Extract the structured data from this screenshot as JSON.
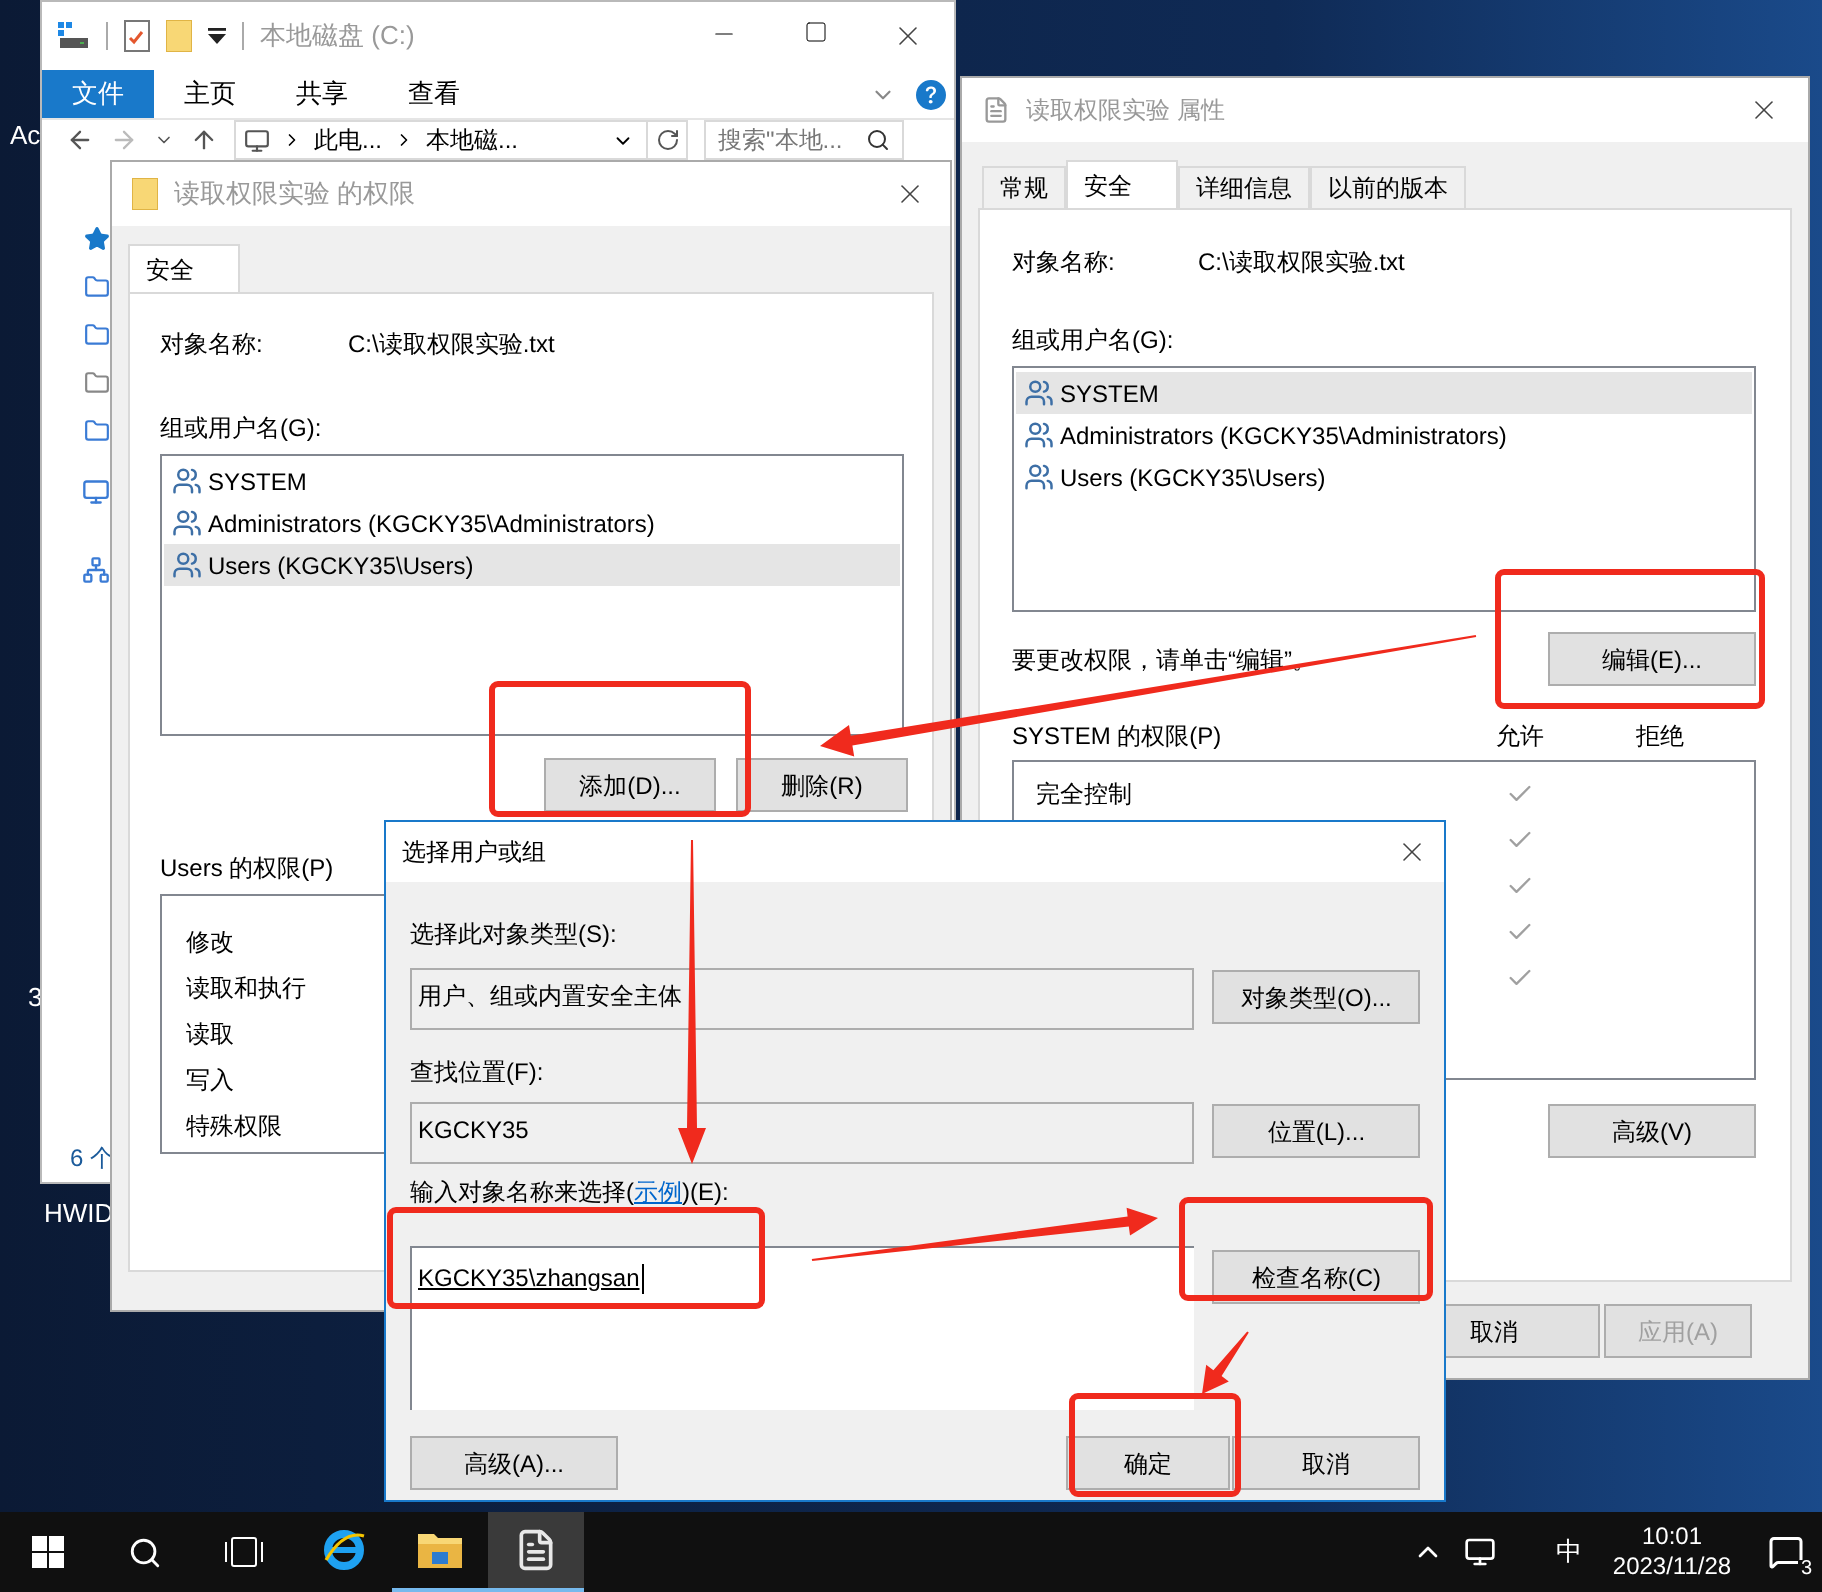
{
  "desktop": {
    "icons": [
      {
        "label": "Ac"
      },
      {
        "label": "3"
      },
      {
        "label": "HWID"
      }
    ]
  },
  "explorer": {
    "title": "本地磁盘 (C:)",
    "ribbon_tabs": [
      {
        "label": "文件",
        "selected": true
      },
      {
        "label": "主页",
        "selected": false
      },
      {
        "label": "共享",
        "selected": false
      },
      {
        "label": "查看",
        "selected": false
      }
    ],
    "breadcrumb": [
      "此电...",
      "本地磁..."
    ],
    "search": {
      "placeholder": "搜索\"本地..."
    },
    "status_bar": "6 个"
  },
  "properties": {
    "title": "读取权限实验 属性",
    "tabs": [
      {
        "label": "常规",
        "selected": false
      },
      {
        "label": "安全",
        "selected": true
      },
      {
        "label": "详细信息",
        "selected": false
      },
      {
        "label": "以前的版本",
        "selected": false
      }
    ],
    "object_label": "对象名称:",
    "object_value": "C:\\读取权限实验.txt",
    "groups_label": "组或用户名(G):",
    "groups": [
      {
        "name": "SYSTEM",
        "selected": true
      },
      {
        "name": "Administrators (KGCKY35\\Administrators)",
        "selected": false
      },
      {
        "name": "Users (KGCKY35\\Users)",
        "selected": false
      }
    ],
    "hint": "要更改权限，请单击“编辑”。",
    "edit_button": "编辑(E)...",
    "permissions_label": "SYSTEM 的权限(P)",
    "allow_header": "允许",
    "deny_header": "拒绝",
    "permissions": [
      {
        "name": "完全控制",
        "allow": true
      },
      {
        "allow": true
      },
      {
        "allow": true
      },
      {
        "allow": true
      },
      {
        "allow": true
      }
    ],
    "advanced_button": "高级(V)",
    "buttons": [
      {
        "label": "取消",
        "disabled": false
      },
      {
        "label": "应用(A)",
        "disabled": true
      }
    ]
  },
  "permissions_window": {
    "title": "读取权限实验 的权限",
    "tabs": [
      {
        "label": "安全",
        "selected": true
      }
    ],
    "object_label": "对象名称:",
    "object_value": "C:\\读取权限实验.txt",
    "groups_label": "组或用户名(G):",
    "groups": [
      {
        "name": "SYSTEM",
        "selected": false
      },
      {
        "name": "Administrators (KGCKY35\\Administrators)",
        "selected": false
      },
      {
        "name": "Users (KGCKY35\\Users)",
        "selected": true
      }
    ],
    "add_button": "添加(D)...",
    "remove_button": "删除(R)",
    "permissions_label": "Users 的权限(P)",
    "permissions": [
      {
        "name": "修改"
      },
      {
        "name": "读取和执行"
      },
      {
        "name": "读取"
      },
      {
        "name": "写入"
      },
      {
        "name": "特殊权限"
      }
    ]
  },
  "select_dialog": {
    "title": "选择用户或组",
    "object_type_label": "选择此对象类型(S):",
    "object_type_value": "用户、组或内置安全主体",
    "object_type_button": "对象类型(O)...",
    "location_label": "查找位置(F):",
    "location_value": "KGCKY35",
    "location_button": "位置(L)...",
    "names_label_before": "输入对象名称来选择(",
    "names_label_link": "示例",
    "names_label_after": ")(E):",
    "names_value": "KGCKY35\\zhangsan",
    "check_names_button": "检查名称(C)",
    "advanced_button": "高级(A)...",
    "ok_button": "确定",
    "cancel_button": "取消"
  },
  "taskbar": {
    "apps": [
      {
        "kind": "browser",
        "running": false,
        "selected": false
      },
      {
        "kind": "folder",
        "running": true,
        "selected": false
      },
      {
        "kind": "notepad",
        "running": true,
        "selected": true
      }
    ],
    "ime": "中",
    "time": "10:01",
    "date": "2023/11/28",
    "notification_count": "3"
  }
}
